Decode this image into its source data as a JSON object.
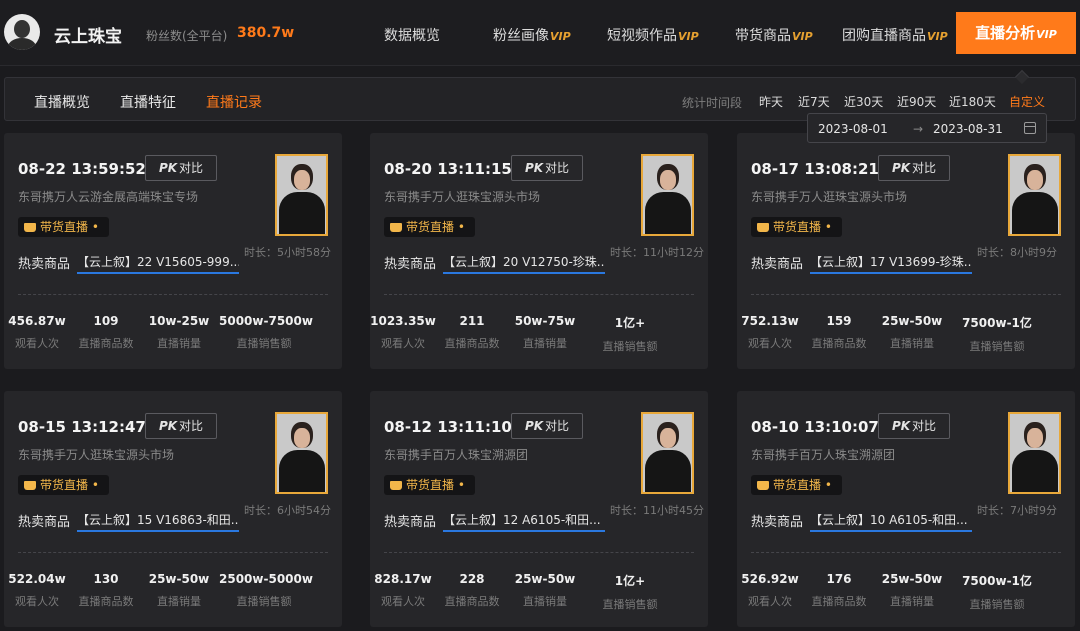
{
  "header": {
    "shop_name": "云上珠宝",
    "fans_label": "粉丝数(全平台)",
    "fans_value": "380.7w",
    "nav": [
      {
        "label": "数据概览",
        "vip": ""
      },
      {
        "label": "粉丝画像",
        "vip": "VIP"
      },
      {
        "label": "短视频作品",
        "vip": "VIP"
      },
      {
        "label": "带货商品",
        "vip": "VIP"
      },
      {
        "label": "团购直播商品",
        "vip": "VIP"
      }
    ],
    "active_nav": {
      "label": "直播分析",
      "vip": "VIP"
    }
  },
  "subnav": {
    "tabs": [
      "直播概览",
      "直播特征",
      "直播记录"
    ],
    "active_tab": 2,
    "range_label": "统计时间段",
    "ranges": [
      "昨天",
      "近7天",
      "近30天",
      "近90天",
      "近180天",
      "自定义"
    ],
    "active_range": 5
  },
  "date_range": {
    "start": "2023-08-01",
    "arrow": "→",
    "end": "2023-08-31"
  },
  "card_labels": {
    "pk": "对比",
    "pk_mark": "PK",
    "badge": "带货直播",
    "hot": "热卖商品",
    "stats": [
      "观看人次",
      "直播商品数",
      "直播销量",
      "直播销售额"
    ]
  },
  "cards": [
    {
      "time": "08-22 13:59:52",
      "title": "东哥携万人云游金展高端珠宝专场",
      "duration": "时长：5小时58分",
      "hot_item": "【云上叙】22 V15605-999...",
      "stats": [
        "456.87w",
        "109",
        "10w-25w",
        "5000w-7500w"
      ]
    },
    {
      "time": "08-20 13:11:15",
      "title": "东哥携手万人逛珠宝源头市场",
      "duration": "时长：11小时12分",
      "hot_item": "【云上叙】20 V12750-珍珠...",
      "stats": [
        "1023.35w",
        "211",
        "50w-75w",
        "1亿+"
      ]
    },
    {
      "time": "08-17 13:08:21",
      "title": "东哥携手万人逛珠宝源头市场",
      "duration": "时长：8小时9分",
      "hot_item": "【云上叙】17 V13699-珍珠...",
      "stats": [
        "752.13w",
        "159",
        "25w-50w",
        "7500w-1亿"
      ]
    },
    {
      "time": "08-15 13:12:47",
      "title": "东哥携手万人逛珠宝源头市场",
      "duration": "时长：6小时54分",
      "hot_item": "【云上叙】15 V16863-和田...",
      "stats": [
        "522.04w",
        "130",
        "25w-50w",
        "2500w-5000w"
      ]
    },
    {
      "time": "08-12 13:11:10",
      "title": "东哥携手百万人珠宝溯源团",
      "duration": "时长：11小时45分",
      "hot_item": "【云上叙】12 A6105-和田...",
      "stats": [
        "828.17w",
        "228",
        "25w-50w",
        "1亿+"
      ]
    },
    {
      "time": "08-10 13:10:07",
      "title": "东哥携手百万人珠宝溯源团",
      "duration": "时长：7小时9分",
      "hot_item": "【云上叙】10 A6105-和田...",
      "stats": [
        "526.92w",
        "176",
        "25w-50w",
        "7500w-1亿"
      ]
    }
  ]
}
